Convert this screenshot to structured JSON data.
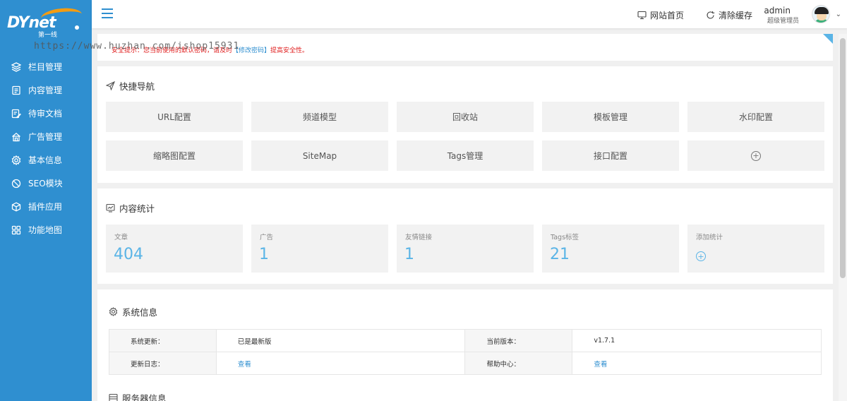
{
  "brand": {
    "logo_text": "DYnet",
    "logo_sub": "第一线"
  },
  "watermark": "https://www.huzhan.com/ishop15931",
  "sidebar": {
    "items": [
      {
        "label": "栏目管理",
        "icon": "layers-icon"
      },
      {
        "label": "内容管理",
        "icon": "document-icon"
      },
      {
        "label": "待审文档",
        "icon": "edit-document-icon"
      },
      {
        "label": "广告管理",
        "icon": "house-icon"
      },
      {
        "label": "基本信息",
        "icon": "gear-icon"
      },
      {
        "label": "SEO模块",
        "icon": "seo-icon"
      },
      {
        "label": "插件应用",
        "icon": "cube-icon"
      },
      {
        "label": "功能地图",
        "icon": "grid-icon"
      }
    ]
  },
  "header": {
    "site_home": "网站首页",
    "clear_cache": "清除缓存",
    "user_name": "admin",
    "user_role": "超级管理员"
  },
  "notice": {
    "text_before": "安全提示：您当前使用的默认密码，请及时",
    "link": "【修改密码】",
    "text_after": "提高安全性。"
  },
  "quick_nav": {
    "title": "快捷导航",
    "buttons": [
      "URL配置",
      "频道模型",
      "回收站",
      "模板管理",
      "水印配置",
      "缩略图配置",
      "SiteMap",
      "Tags管理",
      "接口配置"
    ],
    "add_symbol": "+"
  },
  "stats": {
    "title": "内容统计",
    "items": [
      {
        "label": "文章",
        "value": "404"
      },
      {
        "label": "广告",
        "value": "1"
      },
      {
        "label": "友情链接",
        "value": "1"
      },
      {
        "label": "Tags标签",
        "value": "21"
      }
    ],
    "add_label": "添加统计",
    "add_symbol": "+"
  },
  "system_info": {
    "title": "系统信息",
    "rows": [
      {
        "label1": "系统更新：",
        "value1": "已是最新版",
        "label2": "当前版本：",
        "value2": "v1.7.1"
      },
      {
        "label1": "更新日志：",
        "value1": "查看",
        "label2": "帮助中心：",
        "value2": "查看"
      }
    ]
  },
  "server_info": {
    "title": "服务器信息"
  },
  "colors": {
    "sidebar": "#2f8fd0",
    "accent": "#5ab4e6",
    "notice_red": "#e02020",
    "logo_orange": "#f39c12"
  }
}
